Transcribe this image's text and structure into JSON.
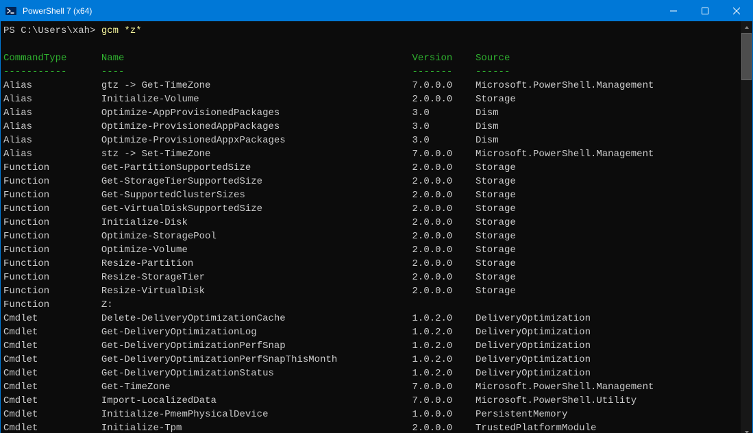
{
  "window": {
    "title": "PowerShell 7 (x64)"
  },
  "prompt": {
    "prefix": "PS C:\\Users\\xah> ",
    "cmd": "gcm *z*"
  },
  "headers": {
    "type": "CommandType",
    "name": "Name",
    "version": "Version",
    "source": "Source",
    "type_u": "-----------",
    "name_u": "----",
    "version_u": "-------",
    "source_u": "------"
  },
  "rows": [
    {
      "type": "Alias",
      "name": "gtz -> Get-TimeZone",
      "version": "7.0.0.0",
      "source": "Microsoft.PowerShell.Management"
    },
    {
      "type": "Alias",
      "name": "Initialize-Volume",
      "version": "2.0.0.0",
      "source": "Storage"
    },
    {
      "type": "Alias",
      "name": "Optimize-AppProvisionedPackages",
      "version": "3.0",
      "source": "Dism"
    },
    {
      "type": "Alias",
      "name": "Optimize-ProvisionedAppPackages",
      "version": "3.0",
      "source": "Dism"
    },
    {
      "type": "Alias",
      "name": "Optimize-ProvisionedAppxPackages",
      "version": "3.0",
      "source": "Dism"
    },
    {
      "type": "Alias",
      "name": "stz -> Set-TimeZone",
      "version": "7.0.0.0",
      "source": "Microsoft.PowerShell.Management"
    },
    {
      "type": "Function",
      "name": "Get-PartitionSupportedSize",
      "version": "2.0.0.0",
      "source": "Storage"
    },
    {
      "type": "Function",
      "name": "Get-StorageTierSupportedSize",
      "version": "2.0.0.0",
      "source": "Storage"
    },
    {
      "type": "Function",
      "name": "Get-SupportedClusterSizes",
      "version": "2.0.0.0",
      "source": "Storage"
    },
    {
      "type": "Function",
      "name": "Get-VirtualDiskSupportedSize",
      "version": "2.0.0.0",
      "source": "Storage"
    },
    {
      "type": "Function",
      "name": "Initialize-Disk",
      "version": "2.0.0.0",
      "source": "Storage"
    },
    {
      "type": "Function",
      "name": "Optimize-StoragePool",
      "version": "2.0.0.0",
      "source": "Storage"
    },
    {
      "type": "Function",
      "name": "Optimize-Volume",
      "version": "2.0.0.0",
      "source": "Storage"
    },
    {
      "type": "Function",
      "name": "Resize-Partition",
      "version": "2.0.0.0",
      "source": "Storage"
    },
    {
      "type": "Function",
      "name": "Resize-StorageTier",
      "version": "2.0.0.0",
      "source": "Storage"
    },
    {
      "type": "Function",
      "name": "Resize-VirtualDisk",
      "version": "2.0.0.0",
      "source": "Storage"
    },
    {
      "type": "Function",
      "name": "Z:",
      "version": "",
      "source": ""
    },
    {
      "type": "Cmdlet",
      "name": "Delete-DeliveryOptimizationCache",
      "version": "1.0.2.0",
      "source": "DeliveryOptimization"
    },
    {
      "type": "Cmdlet",
      "name": "Get-DeliveryOptimizationLog",
      "version": "1.0.2.0",
      "source": "DeliveryOptimization"
    },
    {
      "type": "Cmdlet",
      "name": "Get-DeliveryOptimizationPerfSnap",
      "version": "1.0.2.0",
      "source": "DeliveryOptimization"
    },
    {
      "type": "Cmdlet",
      "name": "Get-DeliveryOptimizationPerfSnapThisMonth",
      "version": "1.0.2.0",
      "source": "DeliveryOptimization"
    },
    {
      "type": "Cmdlet",
      "name": "Get-DeliveryOptimizationStatus",
      "version": "1.0.2.0",
      "source": "DeliveryOptimization"
    },
    {
      "type": "Cmdlet",
      "name": "Get-TimeZone",
      "version": "7.0.0.0",
      "source": "Microsoft.PowerShell.Management"
    },
    {
      "type": "Cmdlet",
      "name": "Import-LocalizedData",
      "version": "7.0.0.0",
      "source": "Microsoft.PowerShell.Utility"
    },
    {
      "type": "Cmdlet",
      "name": "Initialize-PmemPhysicalDevice",
      "version": "1.0.0.0",
      "source": "PersistentMemory"
    },
    {
      "type": "Cmdlet",
      "name": "Initialize-Tpm",
      "version": "2.0.0.0",
      "source": "TrustedPlatformModule"
    }
  ],
  "columns": {
    "c0": 0,
    "c1": 17,
    "c2": 71,
    "c3": 82
  },
  "scrollbar": {
    "thumb_top_pct": 0,
    "thumb_height_pct": 12
  }
}
